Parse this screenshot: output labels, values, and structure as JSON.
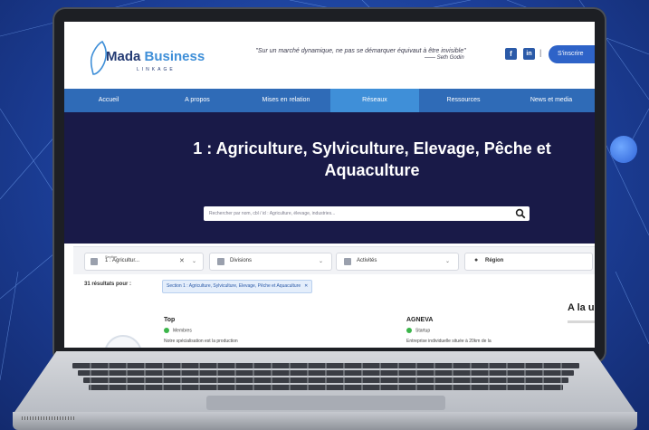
{
  "colors": {
    "background": "#1c3f99",
    "brand_dark": "#233a73",
    "brand_blue": "#3f8fd8",
    "nav_bg": "#2f6bb7",
    "hero_bg": "#191a48",
    "signup_bg": "#2e63c8",
    "status_green": "#3bb54a"
  },
  "header": {
    "logo_name_part1": "Mada",
    "logo_name_part2": "Business",
    "logo_sub": "LINKAGE",
    "quote": "\"Sur un marché dynamique, ne pas se démarquer équivaut à être invisible\"",
    "quote_author": "—— Seth Godin",
    "social": [
      {
        "icon": "facebook-icon",
        "glyph": "f"
      },
      {
        "icon": "linkedin-icon",
        "glyph": "in"
      }
    ],
    "separator": "|",
    "signup_label": "S'inscrire"
  },
  "nav": {
    "items": [
      {
        "label": "Accueil"
      },
      {
        "label": "A propos"
      },
      {
        "label": "Mises en relation"
      },
      {
        "label": "Réseaux"
      },
      {
        "label": "Ressources"
      },
      {
        "label": "News et media"
      }
    ],
    "active_index": 3
  },
  "hero": {
    "title_line1": "1 : Agriculture, Sylviculture, Elevage, Pêche et",
    "title_line2": "Aquaculture",
    "search_placeholder": "Rechercher par nom, cbl / id : Agriculture, élevage, industries..."
  },
  "filters": {
    "section": {
      "label": "Section",
      "value": "1 : Agricultur...",
      "clear": "✕",
      "caret": "⌄"
    },
    "division": {
      "value": "Divisions",
      "caret": "⌄"
    },
    "activity": {
      "value": "Activités",
      "caret": "⌄"
    },
    "region": {
      "value": "Région"
    }
  },
  "results": {
    "label": "31 résultats pour :",
    "tag": "Section 1 : Agriculture, Sylviculture, Elevage, Pêche et Aquaculture",
    "tag_remove": "✕"
  },
  "cards": [
    {
      "title": "Top",
      "status": "Membres",
      "desc": "Notre spécialisation est la production"
    },
    {
      "title": "AGNEVA",
      "status": "Startup",
      "desc": "Entreprise individuelle située à 20km de la"
    }
  ],
  "sidebar": {
    "heading": "A la u"
  }
}
